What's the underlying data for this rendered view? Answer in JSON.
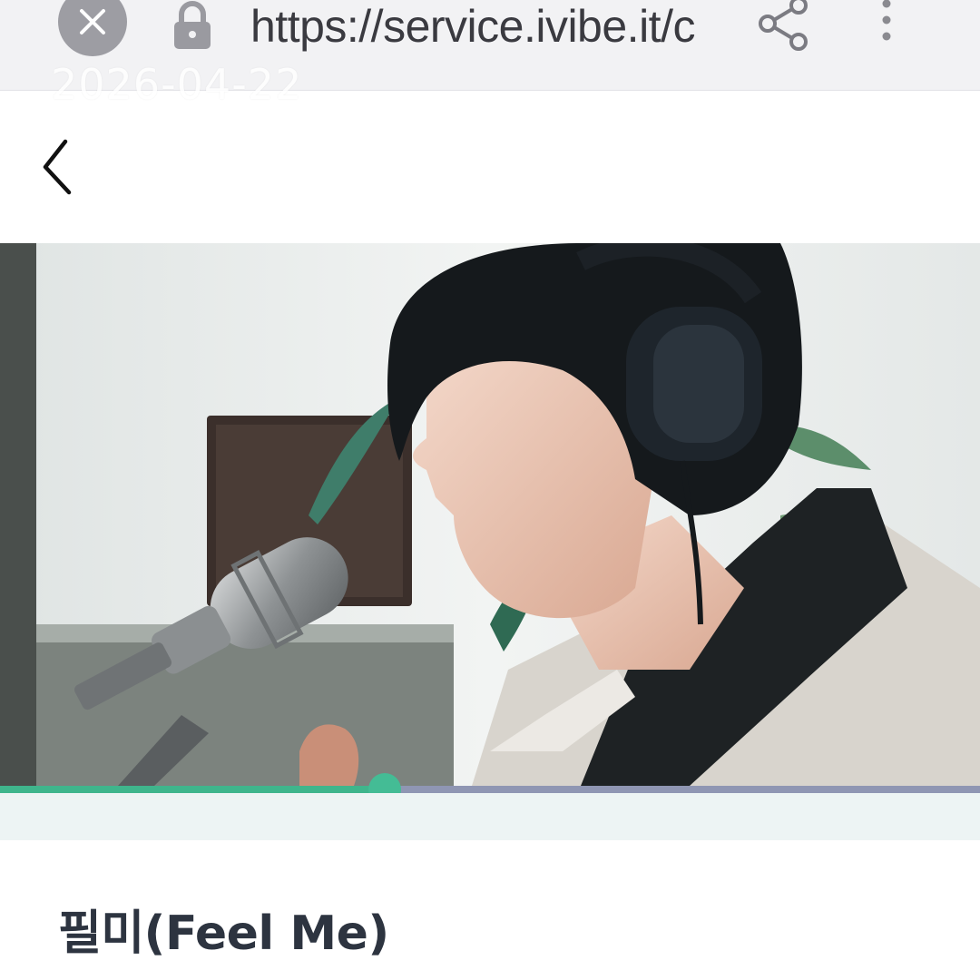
{
  "browser": {
    "url": "https://service.ivibe.it/c",
    "close_icon": "close-icon",
    "lock_icon": "lock-icon",
    "share_icon": "share-icon",
    "more_icon": "more-vertical-icon"
  },
  "overlay": {
    "date": "2026-04-22"
  },
  "header": {
    "back_icon": "chevron-left-icon"
  },
  "player": {
    "progress_fraction": 0.393,
    "colors": {
      "played": "#3fb58c",
      "remaining": "#8f96b3",
      "thumb": "#44bc95"
    }
  },
  "song": {
    "title": "필미(Feel Me)"
  }
}
